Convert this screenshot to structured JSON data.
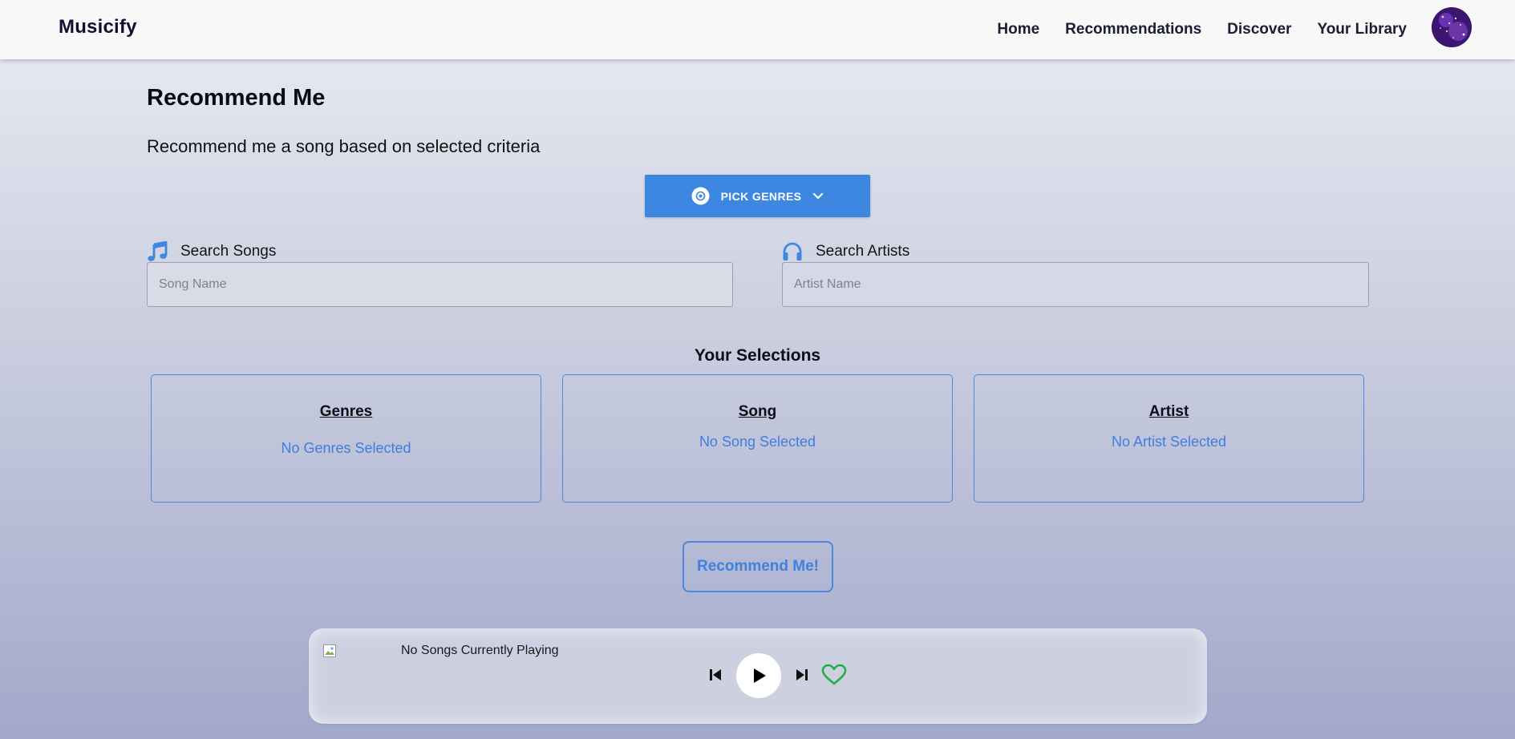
{
  "app": {
    "name": "Musicify"
  },
  "nav": {
    "links": [
      "Home",
      "Recommendations",
      "Discover",
      "Your Library"
    ]
  },
  "main": {
    "title": "Recommend Me",
    "subtitle": "Recommend me a song based on selected criteria",
    "pick_genres_label": "PICK GENRES"
  },
  "search": {
    "songs": {
      "label": "Search Songs",
      "placeholder": "Song Name",
      "value": ""
    },
    "artists": {
      "label": "Search Artists",
      "placeholder": "Artist Name",
      "value": ""
    }
  },
  "selections": {
    "title": "Your Selections",
    "cards": [
      {
        "title": "Genres",
        "empty_text": "No Genres Selected"
      },
      {
        "title": "Song",
        "empty_text": "No Song Selected"
      },
      {
        "title": "Artist",
        "empty_text": "No Artist Selected"
      }
    ]
  },
  "recommend_button_label": "Recommend Me!",
  "player": {
    "now_playing": "No Songs Currently Playing",
    "liked": false
  },
  "colors": {
    "accent": "#3d87e0",
    "card_border": "#4a89e0",
    "like_green": "#22b04b"
  }
}
